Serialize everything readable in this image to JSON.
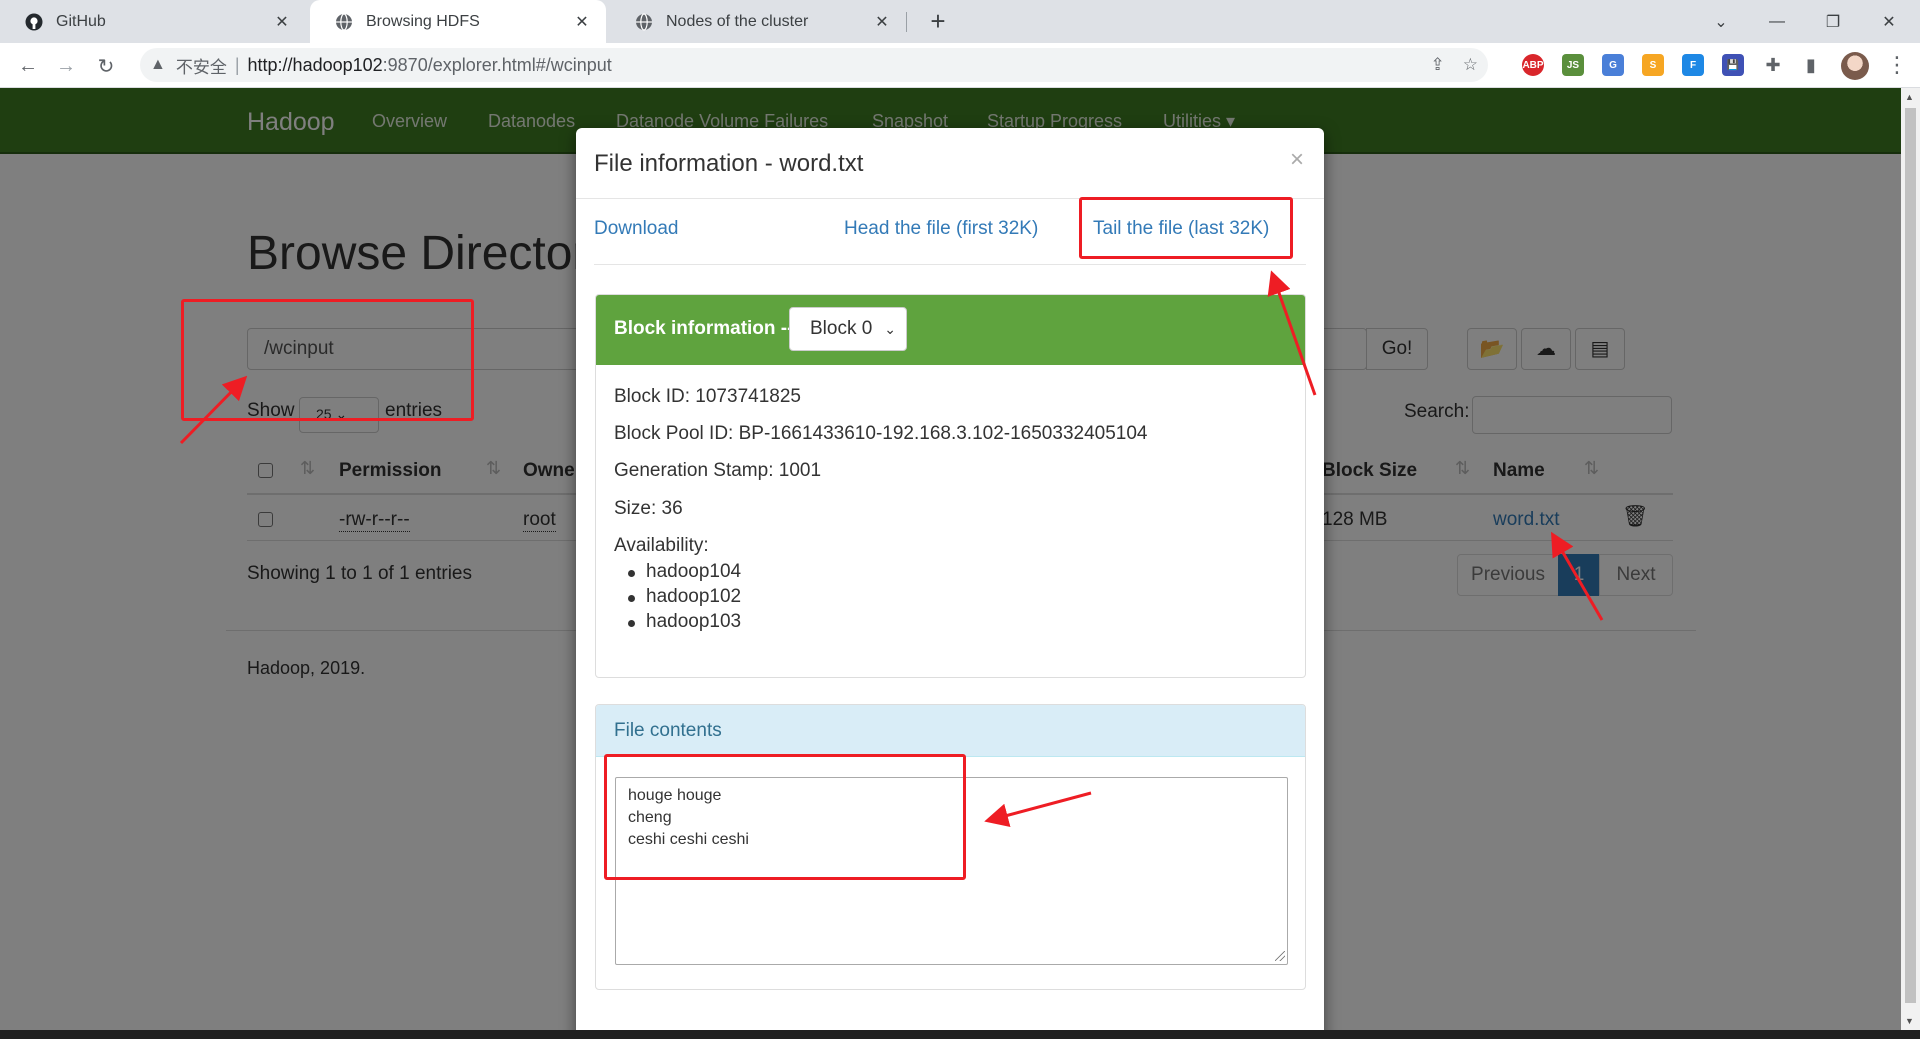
{
  "browser": {
    "tabs": [
      {
        "title": "GitHub",
        "icon": "github-icon",
        "active": false
      },
      {
        "title": "Browsing HDFS",
        "icon": "globe-icon",
        "active": true
      },
      {
        "title": "Nodes of the cluster",
        "icon": "globe-icon",
        "active": false
      }
    ],
    "address": {
      "security_label": "不安全",
      "url_host": "http://hadoop102",
      "url_path": ":9870/explorer.html#/wcinput"
    },
    "extensions": [
      {
        "label": "ABP",
        "color": "#d9262b"
      },
      {
        "label": "JS",
        "color": "#5a8f3c"
      },
      {
        "label": "G",
        "color": "#4a7fd8"
      },
      {
        "label": "S",
        "color": "#f6a623"
      },
      {
        "label": "F",
        "color": "#1e88e5"
      },
      {
        "label": "💾",
        "color": "#3f51b5"
      }
    ]
  },
  "navbar": {
    "brand": "Hadoop",
    "links": [
      "Overview",
      "Datanodes",
      "Datanode Volume Failures",
      "Snapshot",
      "Startup Progress",
      "Utilities ▾"
    ]
  },
  "page": {
    "heading": "Browse Directory",
    "path_value": "/wcinput",
    "go_label": "Go!",
    "show_label": "Show",
    "show_value": "25",
    "entries_label": "entries",
    "search_label": "Search:",
    "columns": [
      "Permission",
      "Owner",
      "Block Size",
      "Name"
    ],
    "rows": [
      {
        "permission": "-rw-r--r--",
        "owner": "root",
        "block_size": "128 MB",
        "name": "word.txt"
      }
    ],
    "showing_text": "Showing 1 to 1 of 1 entries",
    "pagination": {
      "previous": "Previous",
      "current": "1",
      "next": "Next"
    },
    "footer": "Hadoop, 2019."
  },
  "modal": {
    "title": "File information - word.txt",
    "close": "×",
    "links": {
      "download": "Download",
      "head": "Head the file (first 32K)",
      "tail": "Tail the file (last 32K)"
    },
    "block_panel": {
      "title": "Block information --",
      "selected_block": "Block 0",
      "block_id": "Block ID: 1073741825",
      "block_pool_id": "Block Pool ID: BP-1661433610-192.168.3.102-1650332405104",
      "generation_stamp": "Generation Stamp: 1001",
      "size": "Size: 36",
      "availability_label": "Availability:",
      "availability": [
        "hadoop104",
        "hadoop102",
        "hadoop103"
      ]
    },
    "contents_panel": {
      "title": "File contents",
      "text": "houge houge\ncheng\nceshi ceshi ceshi"
    }
  },
  "colors": {
    "navbar": "#3e7c22",
    "block_header": "#5fa33e",
    "link": "#337ab7",
    "annotation": "#ee1d24",
    "pager_active": "#337ab7"
  }
}
